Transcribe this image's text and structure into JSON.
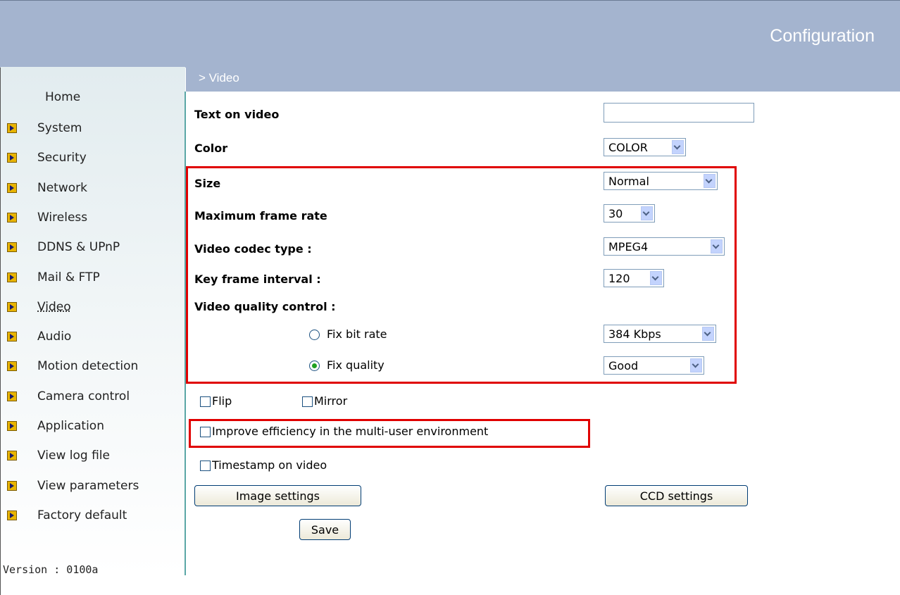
{
  "header": {
    "title": "Configuration"
  },
  "section": {
    "title": "> Video"
  },
  "sidebar": {
    "home": "Home",
    "items": [
      {
        "label": "System"
      },
      {
        "label": "Security"
      },
      {
        "label": "Network"
      },
      {
        "label": "Wireless"
      },
      {
        "label": "DDNS & UPnP"
      },
      {
        "label": "Mail & FTP"
      },
      {
        "label": "Video",
        "current": true
      },
      {
        "label": "Audio"
      },
      {
        "label": "Motion detection"
      },
      {
        "label": "Camera control"
      },
      {
        "label": "Application"
      },
      {
        "label": "View log file"
      },
      {
        "label": "View parameters"
      },
      {
        "label": "Factory default"
      }
    ],
    "version": "Version : 0100a"
  },
  "form": {
    "text_on_video": {
      "label": "Text on video",
      "value": ""
    },
    "color": {
      "label": "Color",
      "selected": "COLOR"
    },
    "size": {
      "label": "Size",
      "selected": "Normal"
    },
    "max_frame_rate": {
      "label": "Maximum frame rate",
      "selected": "30"
    },
    "codec": {
      "label": "Video codec type :",
      "selected": "MPEG4"
    },
    "key_frame": {
      "label": "Key frame interval :",
      "selected": "120"
    },
    "quality_control": {
      "label": "Video quality control :",
      "fix_bit_rate": {
        "label": "Fix bit rate",
        "checked": false,
        "selected": "384 Kbps"
      },
      "fix_quality": {
        "label": "Fix quality",
        "checked": true,
        "selected": "Good"
      }
    },
    "flip": {
      "label": "Flip",
      "checked": false
    },
    "mirror": {
      "label": "Mirror",
      "checked": false
    },
    "multi_user": {
      "label": "Improve efficiency in the multi-user environment",
      "checked": false
    },
    "timestamp": {
      "label": "Timestamp on video",
      "checked": false
    },
    "image_settings_button": "Image settings",
    "ccd_settings_button": "CCD settings",
    "save_button": "Save"
  },
  "colors": {
    "header_bg": "#a4b4cf",
    "highlight": "#e00000",
    "sidebar_border": "#5aa7a6"
  }
}
